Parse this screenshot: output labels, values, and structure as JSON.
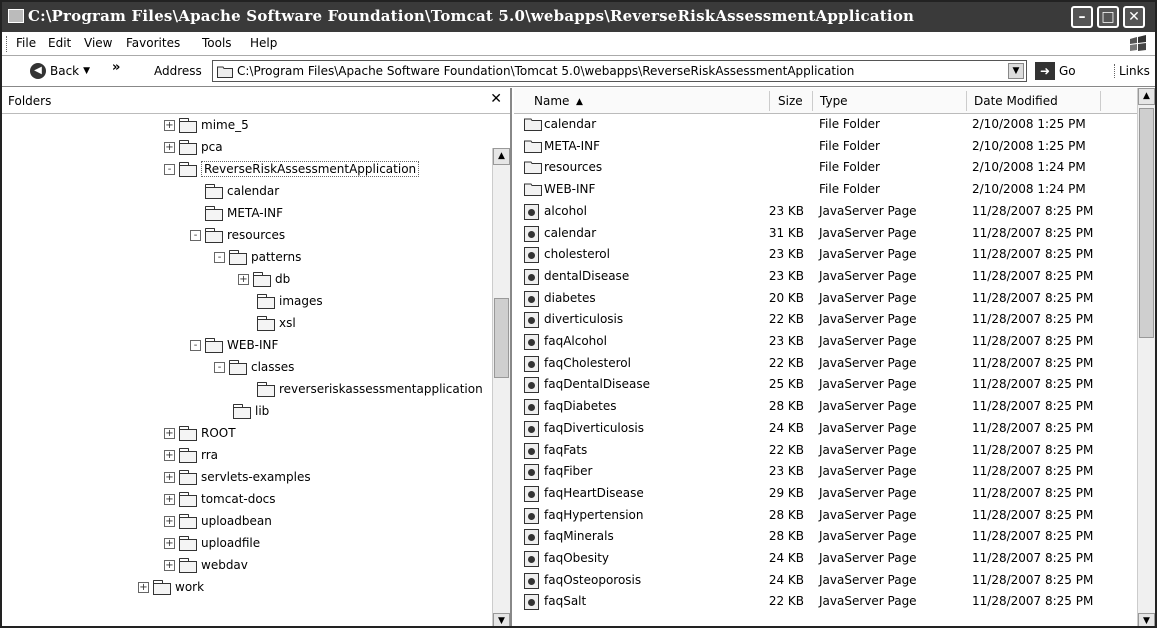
{
  "window": {
    "title": "C:\\Program Files\\Apache Software Foundation\\Tomcat 5.0\\webapps\\ReverseRiskAssessmentApplication"
  },
  "menu": [
    {
      "label": "File"
    },
    {
      "label": "Edit"
    },
    {
      "label": "View"
    },
    {
      "label": "Favorites"
    },
    {
      "label": "Tools"
    },
    {
      "label": "Help"
    }
  ],
  "toolbar": {
    "back_label": "Back",
    "address_label": "Address",
    "address_value": "C:\\Program Files\\Apache Software Foundation\\Tomcat 5.0\\webapps\\ReverseRiskAssessmentApplication",
    "go_label": "Go",
    "links_label": "Links"
  },
  "folders": {
    "title": "Folders",
    "tree": [
      {
        "label": "mime_5",
        "expander": "+"
      },
      {
        "label": "pca",
        "expander": "+"
      },
      {
        "label": "ReverseRiskAssessmentApplication",
        "expander": "-",
        "selected": true
      },
      {
        "label": "calendar",
        "expander": ""
      },
      {
        "label": "META-INF",
        "expander": ""
      },
      {
        "label": "resources",
        "expander": "-"
      },
      {
        "label": "patterns",
        "expander": "-"
      },
      {
        "label": "db",
        "expander": "+"
      },
      {
        "label": "images",
        "expander": ""
      },
      {
        "label": "xsl",
        "expander": ""
      },
      {
        "label": "WEB-INF",
        "expander": "-"
      },
      {
        "label": "classes",
        "expander": "-"
      },
      {
        "label": "reverseriskassessmentapplication",
        "expander": ""
      },
      {
        "label": "lib",
        "expander": ""
      },
      {
        "label": "ROOT",
        "expander": "+"
      },
      {
        "label": "rra",
        "expander": "+"
      },
      {
        "label": "servlets-examples",
        "expander": "+"
      },
      {
        "label": "tomcat-docs",
        "expander": "+"
      },
      {
        "label": "uploadbean",
        "expander": "+"
      },
      {
        "label": "uploadfile",
        "expander": "+"
      },
      {
        "label": "webdav",
        "expander": "+"
      },
      {
        "label": "work",
        "expander": "+"
      }
    ]
  },
  "files": {
    "columns": {
      "name": "Name",
      "size": "Size",
      "type": "Type",
      "date": "Date Modified"
    },
    "rows": [
      {
        "name": "calendar",
        "size": "",
        "type": "File Folder",
        "date": "2/10/2008 1:25 PM",
        "icon": "folder"
      },
      {
        "name": "META-INF",
        "size": "",
        "type": "File Folder",
        "date": "2/10/2008 1:25 PM",
        "icon": "folder"
      },
      {
        "name": "resources",
        "size": "",
        "type": "File Folder",
        "date": "2/10/2008 1:24 PM",
        "icon": "folder"
      },
      {
        "name": "WEB-INF",
        "size": "",
        "type": "File Folder",
        "date": "2/10/2008 1:24 PM",
        "icon": "folder"
      },
      {
        "name": "alcohol",
        "size": "23 KB",
        "type": "JavaServer Page",
        "date": "11/28/2007 8:25 PM",
        "icon": "jsp"
      },
      {
        "name": "calendar",
        "size": "31 KB",
        "type": "JavaServer Page",
        "date": "11/28/2007 8:25 PM",
        "icon": "jsp"
      },
      {
        "name": "cholesterol",
        "size": "23 KB",
        "type": "JavaServer Page",
        "date": "11/28/2007 8:25 PM",
        "icon": "jsp"
      },
      {
        "name": "dentalDisease",
        "size": "23 KB",
        "type": "JavaServer Page",
        "date": "11/28/2007 8:25 PM",
        "icon": "jsp"
      },
      {
        "name": "diabetes",
        "size": "20 KB",
        "type": "JavaServer Page",
        "date": "11/28/2007 8:25 PM",
        "icon": "jsp"
      },
      {
        "name": "diverticulosis",
        "size": "22 KB",
        "type": "JavaServer Page",
        "date": "11/28/2007 8:25 PM",
        "icon": "jsp"
      },
      {
        "name": "faqAlcohol",
        "size": "23 KB",
        "type": "JavaServer Page",
        "date": "11/28/2007 8:25 PM",
        "icon": "jsp"
      },
      {
        "name": "faqCholesterol",
        "size": "22 KB",
        "type": "JavaServer Page",
        "date": "11/28/2007 8:25 PM",
        "icon": "jsp"
      },
      {
        "name": "faqDentalDisease",
        "size": "25 KB",
        "type": "JavaServer Page",
        "date": "11/28/2007 8:25 PM",
        "icon": "jsp"
      },
      {
        "name": "faqDiabetes",
        "size": "28 KB",
        "type": "JavaServer Page",
        "date": "11/28/2007 8:25 PM",
        "icon": "jsp"
      },
      {
        "name": "faqDiverticulosis",
        "size": "24 KB",
        "type": "JavaServer Page",
        "date": "11/28/2007 8:25 PM",
        "icon": "jsp"
      },
      {
        "name": "faqFats",
        "size": "22 KB",
        "type": "JavaServer Page",
        "date": "11/28/2007 8:25 PM",
        "icon": "jsp"
      },
      {
        "name": "faqFiber",
        "size": "23 KB",
        "type": "JavaServer Page",
        "date": "11/28/2007 8:25 PM",
        "icon": "jsp"
      },
      {
        "name": "faqHeartDisease",
        "size": "29 KB",
        "type": "JavaServer Page",
        "date": "11/28/2007 8:25 PM",
        "icon": "jsp"
      },
      {
        "name": "faqHypertension",
        "size": "28 KB",
        "type": "JavaServer Page",
        "date": "11/28/2007 8:25 PM",
        "icon": "jsp"
      },
      {
        "name": "faqMinerals",
        "size": "28 KB",
        "type": "JavaServer Page",
        "date": "11/28/2007 8:25 PM",
        "icon": "jsp"
      },
      {
        "name": "faqObesity",
        "size": "24 KB",
        "type": "JavaServer Page",
        "date": "11/28/2007 8:25 PM",
        "icon": "jsp"
      },
      {
        "name": "faqOsteoporosis",
        "size": "24 KB",
        "type": "JavaServer Page",
        "date": "11/28/2007 8:25 PM",
        "icon": "jsp"
      },
      {
        "name": "faqSalt",
        "size": "22 KB",
        "type": "JavaServer Page",
        "date": "11/28/2007 8:25 PM",
        "icon": "jsp"
      }
    ]
  }
}
